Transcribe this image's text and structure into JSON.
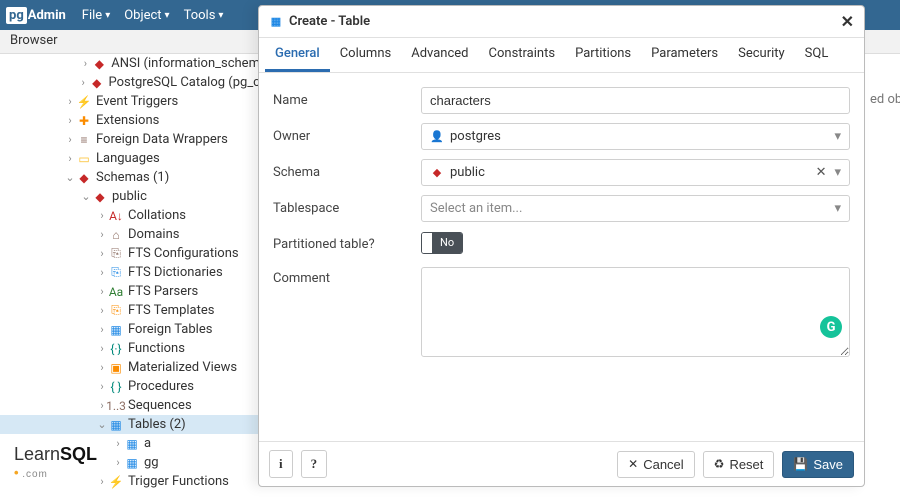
{
  "app": {
    "logo_prefix": "pg",
    "logo_suffix": "Admin",
    "menu": [
      "File",
      "Object",
      "Tools"
    ]
  },
  "browser_label": "Browser",
  "background_message": "ed obj",
  "tree": [
    {
      "indent": 80,
      "caret": "›",
      "icon": "◆",
      "icon_color": "#c62828",
      "label": "ANSI (information_schem"
    },
    {
      "indent": 80,
      "caret": "›",
      "icon": "◆",
      "icon_color": "#c62828",
      "label": "PostgreSQL Catalog (pg_c"
    },
    {
      "indent": 64,
      "caret": "›",
      "icon": "⚡",
      "icon_color": "#1e88e5",
      "label": "Event Triggers"
    },
    {
      "indent": 64,
      "caret": "›",
      "icon": "✚",
      "icon_color": "#fb8c00",
      "label": "Extensions"
    },
    {
      "indent": 64,
      "caret": "›",
      "icon": "≡",
      "icon_color": "#8d6e63",
      "label": "Foreign Data Wrappers"
    },
    {
      "indent": 64,
      "caret": "›",
      "icon": "▭",
      "icon_color": "#fbc02d",
      "label": "Languages"
    },
    {
      "indent": 64,
      "caret": "⌄",
      "icon": "◆",
      "icon_color": "#c62828",
      "label": "Schemas (1)"
    },
    {
      "indent": 80,
      "caret": "⌄",
      "icon": "◆",
      "icon_color": "#c62828",
      "label": "public"
    },
    {
      "indent": 96,
      "caret": "›",
      "icon": "A↓",
      "icon_color": "#c62828",
      "label": "Collations"
    },
    {
      "indent": 96,
      "caret": "›",
      "icon": "⌂",
      "icon_color": "#8d6e63",
      "label": "Domains"
    },
    {
      "indent": 96,
      "caret": "›",
      "icon": "⎘",
      "icon_color": "#8d6e63",
      "label": "FTS Configurations"
    },
    {
      "indent": 96,
      "caret": "›",
      "icon": "⎘",
      "icon_color": "#1e88e5",
      "label": "FTS Dictionaries"
    },
    {
      "indent": 96,
      "caret": "›",
      "icon": "Aa",
      "icon_color": "#2e7d32",
      "label": "FTS Parsers"
    },
    {
      "indent": 96,
      "caret": "›",
      "icon": "⎘",
      "icon_color": "#fb8c00",
      "label": "FTS Templates"
    },
    {
      "indent": 96,
      "caret": "›",
      "icon": "▦",
      "icon_color": "#1e88e5",
      "label": "Foreign Tables"
    },
    {
      "indent": 96,
      "caret": "›",
      "icon": "{·}",
      "icon_color": "#00897b",
      "label": "Functions"
    },
    {
      "indent": 96,
      "caret": "›",
      "icon": "▣",
      "icon_color": "#fb8c00",
      "label": "Materialized Views"
    },
    {
      "indent": 96,
      "caret": "›",
      "icon": "{ }",
      "icon_color": "#00897b",
      "label": "Procedures"
    },
    {
      "indent": 96,
      "caret": "›",
      "icon": "1..3",
      "icon_color": "#8d6e63",
      "label": "Sequences"
    },
    {
      "indent": 96,
      "caret": "⌄",
      "icon": "▦",
      "icon_color": "#1e88e5",
      "label": "Tables (2)",
      "selected": true
    },
    {
      "indent": 112,
      "caret": "›",
      "icon": "▦",
      "icon_color": "#1e88e5",
      "label": "a"
    },
    {
      "indent": 112,
      "caret": "›",
      "icon": "▦",
      "icon_color": "#1e88e5",
      "label": "gg"
    },
    {
      "indent": 96,
      "caret": "›",
      "icon": "⚡",
      "icon_color": "#fb8c00",
      "label": "Trigger Functions"
    }
  ],
  "modal": {
    "title": "Create - Table",
    "tabs": [
      "General",
      "Columns",
      "Advanced",
      "Constraints",
      "Partitions",
      "Parameters",
      "Security",
      "SQL"
    ],
    "active_tab": 0,
    "fields": {
      "name": {
        "label": "Name",
        "value": "characters"
      },
      "owner": {
        "label": "Owner",
        "value": "postgres",
        "icon_color": "#1e88e5"
      },
      "schema": {
        "label": "Schema",
        "value": "public",
        "icon_color": "#c62828",
        "clearable": true
      },
      "tablespace": {
        "label": "Tablespace",
        "placeholder": "Select an item..."
      },
      "partitioned": {
        "label": "Partitioned table?",
        "value": "No"
      },
      "comment": {
        "label": "Comment",
        "value": ""
      }
    },
    "footer": {
      "info": "i",
      "help": "?",
      "cancel": "Cancel",
      "reset": "Reset",
      "save": "Save"
    }
  },
  "watermark": {
    "learn": "Learn",
    "sql": "SQL",
    "sub": ".com"
  }
}
